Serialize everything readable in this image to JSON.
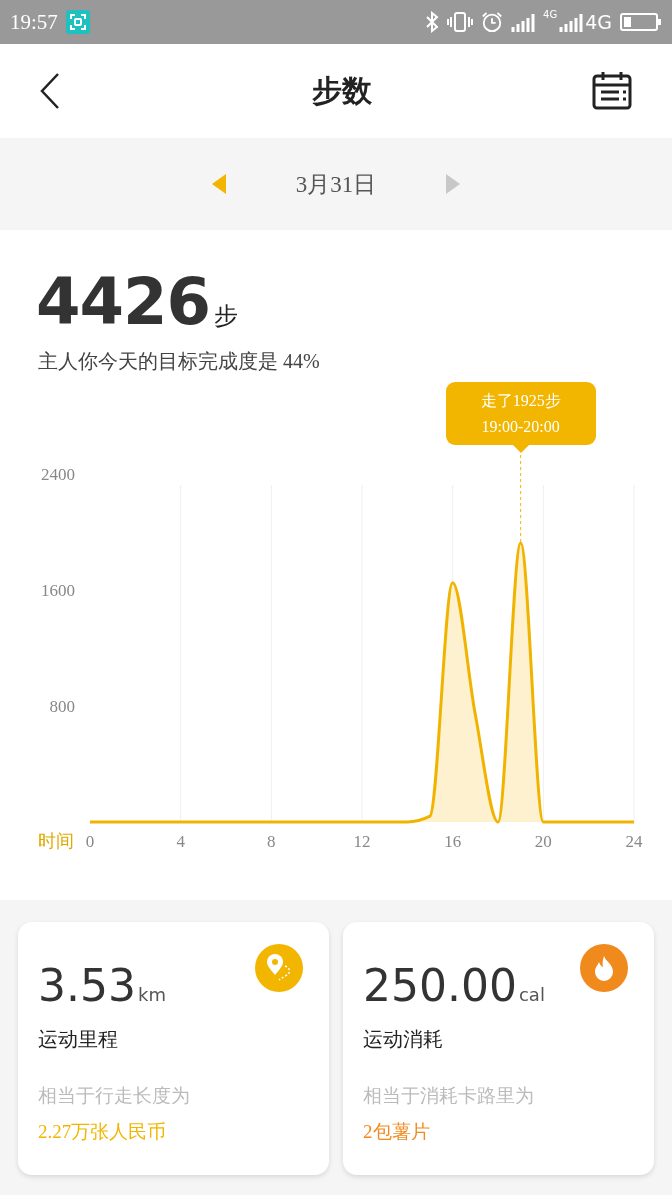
{
  "status_bar": {
    "time": "19:57",
    "network_small": "4G",
    "network": "4G"
  },
  "header": {
    "title": "步数"
  },
  "date_nav": {
    "date": "3月31日",
    "prev_enabled": true,
    "next_enabled": false
  },
  "summary": {
    "steps": "4426",
    "unit": "步",
    "goal_text": "主人你今天的目标完成度是 44%"
  },
  "chart": {
    "tooltip": {
      "line1": "走了1925步",
      "line2": "19:00-20:00"
    },
    "x_title": "时间",
    "chart_data": {
      "type": "area",
      "x": [
        0,
        1,
        2,
        3,
        4,
        5,
        6,
        7,
        8,
        9,
        10,
        11,
        12,
        13,
        14,
        15,
        16,
        17,
        18,
        19,
        20,
        21,
        22,
        23,
        24
      ],
      "series": [
        {
          "color": "#f0b400",
          "values": [
            0,
            0,
            0,
            0,
            0,
            0,
            0,
            0,
            0,
            0,
            0,
            0,
            0,
            0,
            0,
            40,
            1650,
            740,
            0,
            1925,
            0,
            0,
            0,
            0,
            0
          ]
        }
      ],
      "xlim": [
        0,
        24
      ],
      "ylim": [
        0,
        2400
      ],
      "xticks": [
        0,
        4,
        8,
        12,
        16,
        20,
        24
      ],
      "yticks": [
        800,
        1600,
        2400
      ],
      "grid": true
    }
  },
  "cards": [
    {
      "kind": "distance",
      "value": "3.53",
      "unit": "km",
      "label": "运动里程",
      "note": "相当于行走长度为",
      "equivalent": "2.27万张人民币"
    },
    {
      "kind": "calories",
      "value": "250.00",
      "unit": "cal",
      "label": "运动消耗",
      "note": "相当于消耗卡路里为",
      "equivalent": "2包薯片"
    }
  ]
}
